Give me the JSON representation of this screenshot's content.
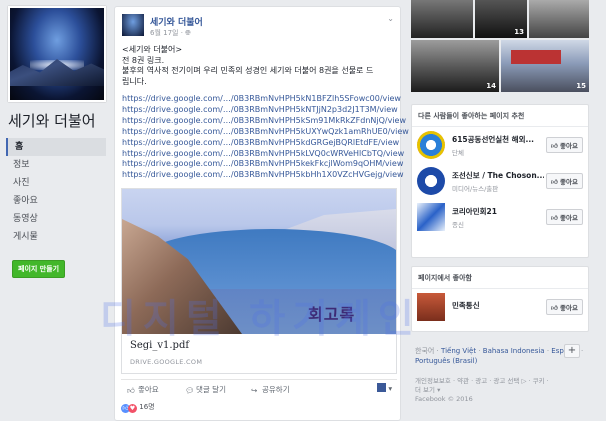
{
  "page": {
    "name": "세기와 더불어"
  },
  "nav": {
    "items": [
      {
        "label": "홈",
        "active": true
      },
      {
        "label": "정보"
      },
      {
        "label": "사진"
      },
      {
        "label": "좋아요"
      },
      {
        "label": "동영상"
      },
      {
        "label": "게시물"
      }
    ],
    "create_page": "페이지 만들기"
  },
  "post": {
    "author": "세기와 더불어",
    "date": "6월 17일",
    "body": [
      "<세기와 더불어>",
      "전 8권 링크.",
      "불후의 역사적 전기이며 우리 민족의 성경인 세기와 더불어 8권을 선물로 드",
      "립니다."
    ],
    "links": [
      "https://drive.google.com/…/0B3RBmNvHPH5kN1BFZlh5SFowc00/view",
      "https://drive.google.com/…/0B3RBmNvHPH5kNTJjN2p3d2J1T3M/view",
      "https://drive.google.com/…/0B3RBmNvHPH5kSm91MkRkZFdnNjQ/view",
      "https://drive.google.com/…/0B3RBmNvHPH5kUXYwQzk1amRhUE0/view",
      "https://drive.google.com/…/0B3RBmNvHPH5kdGRGejBQRlEtdFE/view",
      "https://drive.google.com/…/0B3RBmNvHPH5kLVQ0cWRVeHlCbTQ/view",
      "https://drive.google.com/…/0B3RBmNvHPH5kekFkcjlWom9qOHM/view",
      "https://drive.google.com/…/0B3RBmNvHPH5kbHh1X0VZcHVGejg/view"
    ],
    "attachment": {
      "image_text": "회고록",
      "title": "Segi_v1.pdf",
      "domain": "DRIVE.GOOGLE.COM"
    },
    "actions": {
      "like": "좋아요",
      "comment": "댓글 달기",
      "share": "공유하기"
    },
    "reactions_count": "16명"
  },
  "sidebar": {
    "photo_counts": [
      "13",
      "14",
      "15"
    ],
    "recommend_title": "다른 사람들이 좋아하는 페이지 추천",
    "recommend": [
      {
        "name": "615공동선언실천 해외...",
        "category": "단체"
      },
      {
        "name": "조선신보 / The Choson...",
        "category": "미디어/뉴스/출판"
      },
      {
        "name": "코리아민회21",
        "category": "종신"
      }
    ],
    "liked_title": "페이지에서 좋아함",
    "liked": [
      {
        "name": "민족통신",
        "category": ""
      }
    ],
    "like_button": "좋아요",
    "languages": {
      "current": "한국어",
      "others": [
        "Tiếng Việt",
        "Bahasa Indonesia",
        "Español",
        "Português (Brasil)"
      ],
      "plus": "+"
    },
    "footer_line1": "개인정보보호 · 약관 · 광고 · 광고 선택 ▷ · 쿠키 ·",
    "footer_line2": "더 보기 ▾",
    "copyright": "Facebook © 2016"
  },
  "watermark": "디지털 하기계인"
}
